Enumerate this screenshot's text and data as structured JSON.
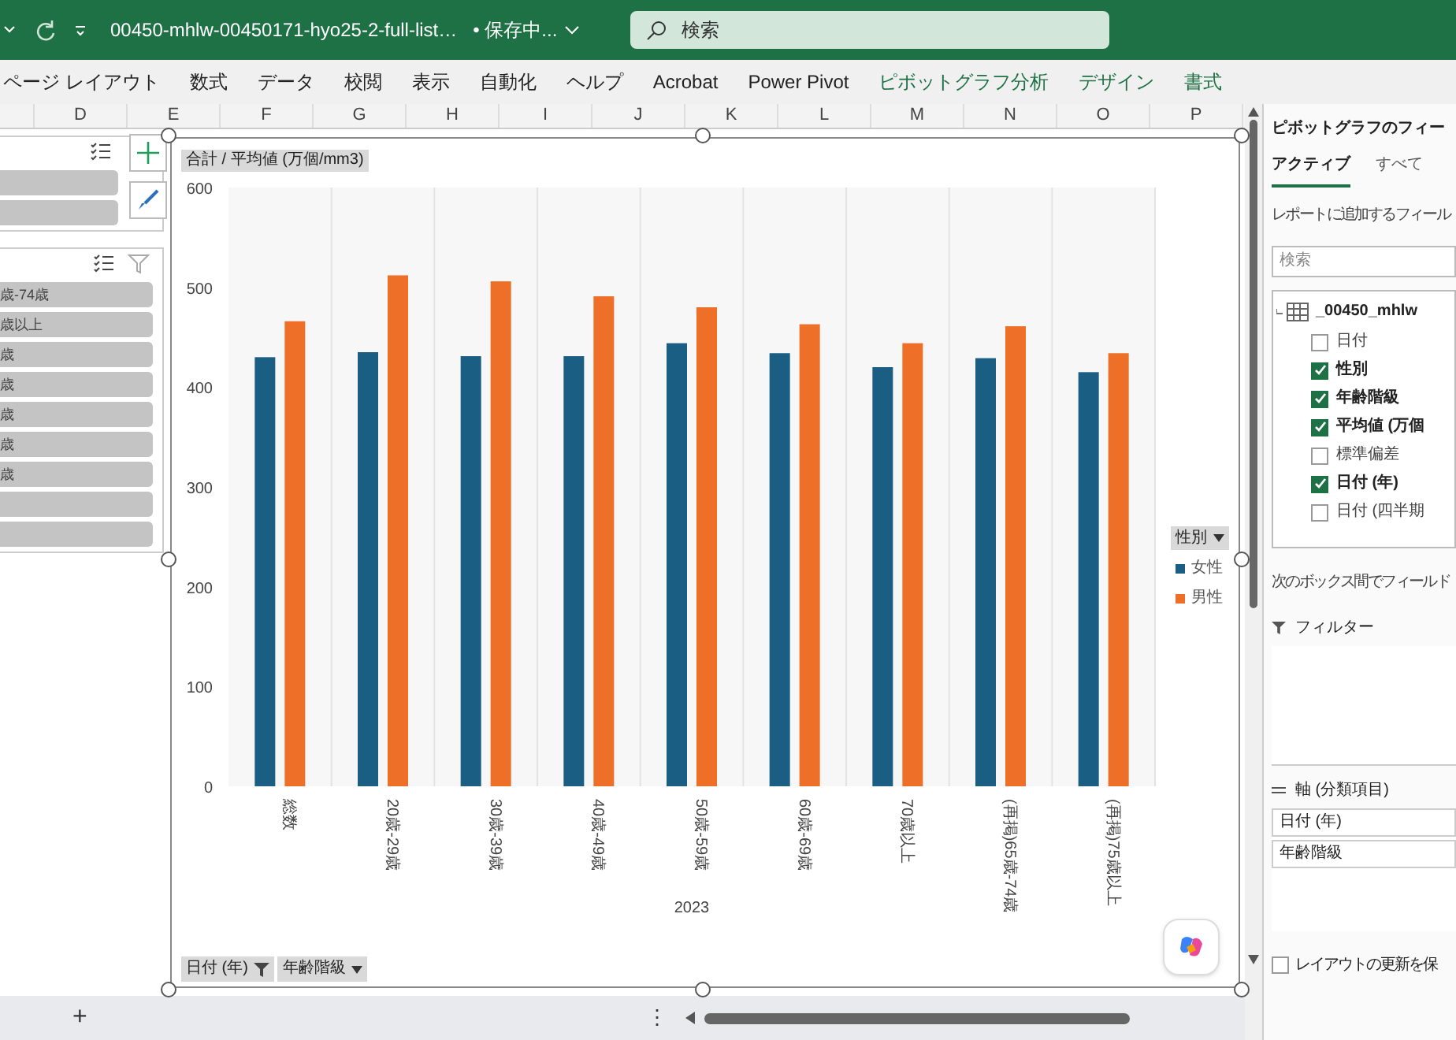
{
  "title_bar": {
    "file_name": "00450-mhlw-00450171-hyo25-2-full-list…",
    "save_status": "• 保存中...",
    "search": {
      "placeholder": "検索"
    }
  },
  "ribbon_tabs": [
    {
      "label": "ページ レイアウト",
      "contextual": false
    },
    {
      "label": "数式",
      "contextual": false
    },
    {
      "label": "データ",
      "contextual": false
    },
    {
      "label": "校閲",
      "contextual": false
    },
    {
      "label": "表示",
      "contextual": false
    },
    {
      "label": "自動化",
      "contextual": false
    },
    {
      "label": "ヘルプ",
      "contextual": false
    },
    {
      "label": "Acrobat",
      "contextual": false
    },
    {
      "label": "Power Pivot",
      "contextual": false
    },
    {
      "label": "ピボットグラフ分析",
      "contextual": true
    },
    {
      "label": "デザイン",
      "contextual": true
    },
    {
      "label": "書式",
      "contextual": true
    }
  ],
  "column_headers": [
    "D",
    "E",
    "F",
    "G",
    "H",
    "I",
    "J",
    "K",
    "L",
    "M",
    "N",
    "O",
    "P"
  ],
  "slicers": [
    {
      "kind": "styles"
    },
    {
      "kind": "list",
      "items": [
        "歳-74歳",
        "歳以上",
        "歳",
        "歳",
        "歳",
        "歳",
        "歳"
      ]
    }
  ],
  "chart": {
    "value_field_button": "合計 / 平均値 (万個/mm3)",
    "axis_field_buttons": [
      "日付 (年)",
      "年齢階級"
    ],
    "legend": {
      "title": "性別"
    },
    "chart_data": {
      "type": "bar",
      "xlabel": "2023",
      "categories": [
        "総数",
        "20歳-29歳",
        "30歳-39歳",
        "40歳-49歳",
        "50歳-59歳",
        "60歳-69歳",
        "70歳以上",
        "(再掲)65歳-74歳",
        "(再掲)75歳以上"
      ],
      "series": [
        {
          "name": "女性",
          "color": "#1b5e83",
          "values": [
            430,
            435,
            431,
            431,
            444,
            434,
            420,
            429,
            415
          ]
        },
        {
          "name": "男性",
          "color": "#ee7028",
          "values": [
            466,
            512,
            506,
            491,
            480,
            463,
            444,
            461,
            434
          ]
        }
      ],
      "ylim": [
        0,
        600
      ],
      "yticks": [
        0,
        100,
        200,
        300,
        400,
        500,
        600
      ]
    }
  },
  "field_pane": {
    "title": "ピボットグラフのフィー",
    "tabs": [
      {
        "label": "アクティブ",
        "selected": true
      },
      {
        "label": "すべて",
        "selected": false
      }
    ],
    "hint": "レポートに追加するフィール",
    "search": {
      "placeholder": "検索"
    },
    "table_name": "_00450_mhlw",
    "fields": [
      {
        "label": "日付",
        "checked": false
      },
      {
        "label": "性別",
        "checked": true
      },
      {
        "label": "年齢階級",
        "checked": true
      },
      {
        "label": "平均値 (万個",
        "checked": true
      },
      {
        "label": "標準偏差",
        "checked": false
      },
      {
        "label": "日付 (年)",
        "checked": true
      },
      {
        "label": "日付 (四半期",
        "checked": false
      }
    ],
    "areas_hint": "次のボックス間でフィールド",
    "filter_label": "フィルター",
    "axis_label": "軸 (分類項目)",
    "axis_items": [
      "日付 (年)",
      "年齢階級"
    ],
    "defer_update": {
      "label": "レイアウトの更新を保",
      "checked": false
    }
  },
  "bottom_bar": {
    "add_sheet": "+",
    "more": "⋮"
  }
}
